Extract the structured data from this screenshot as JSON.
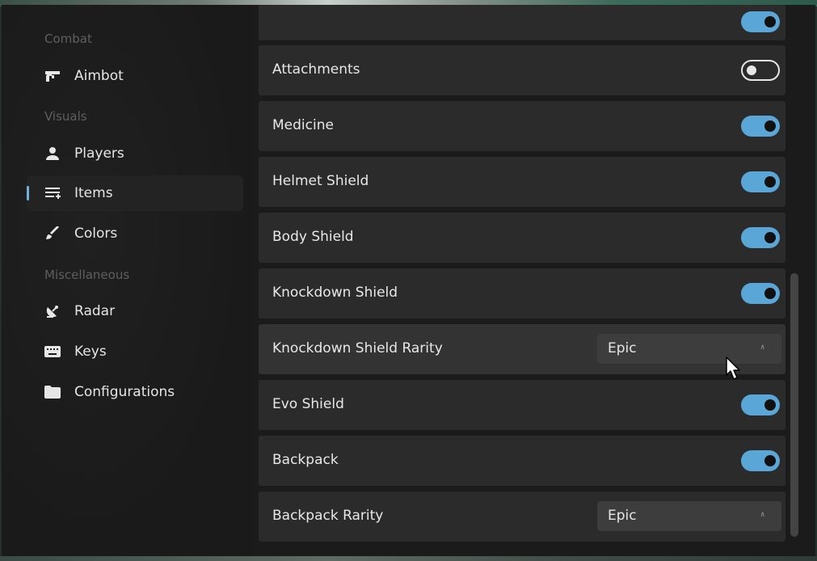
{
  "sidebar": {
    "sections": [
      {
        "label": "Combat"
      },
      {
        "label": "Visuals"
      },
      {
        "label": "Miscellaneous"
      }
    ],
    "items": [
      {
        "label": "Aimbot",
        "icon": "gun-icon"
      },
      {
        "label": "Players",
        "icon": "person-icon"
      },
      {
        "label": "Items",
        "icon": "playlist-add-icon",
        "active": true
      },
      {
        "label": "Colors",
        "icon": "brush-icon"
      },
      {
        "label": "Radar",
        "icon": "satellite-dish-icon"
      },
      {
        "label": "Keys",
        "icon": "keyboard-icon"
      },
      {
        "label": "Configurations",
        "icon": "folder-icon"
      }
    ]
  },
  "settings": [
    {
      "label": "Attachments",
      "type": "toggle",
      "on": false
    },
    {
      "label": "Medicine",
      "type": "toggle",
      "on": true
    },
    {
      "label": "Helmet Shield",
      "type": "toggle",
      "on": true
    },
    {
      "label": "Body Shield",
      "type": "toggle",
      "on": true
    },
    {
      "label": "Knockdown Shield",
      "type": "toggle",
      "on": true
    },
    {
      "label": "Knockdown Shield Rarity",
      "type": "select",
      "value": "Epic"
    },
    {
      "label": "Evo Shield",
      "type": "toggle",
      "on": true
    },
    {
      "label": "Backpack",
      "type": "toggle",
      "on": true
    },
    {
      "label": "Backpack Rarity",
      "type": "select",
      "value": "Epic"
    }
  ],
  "colors": {
    "accent": "#5aa6d6",
    "row_bg": "#2b2b2b",
    "sidebar_bg": "#1b1b1b"
  }
}
